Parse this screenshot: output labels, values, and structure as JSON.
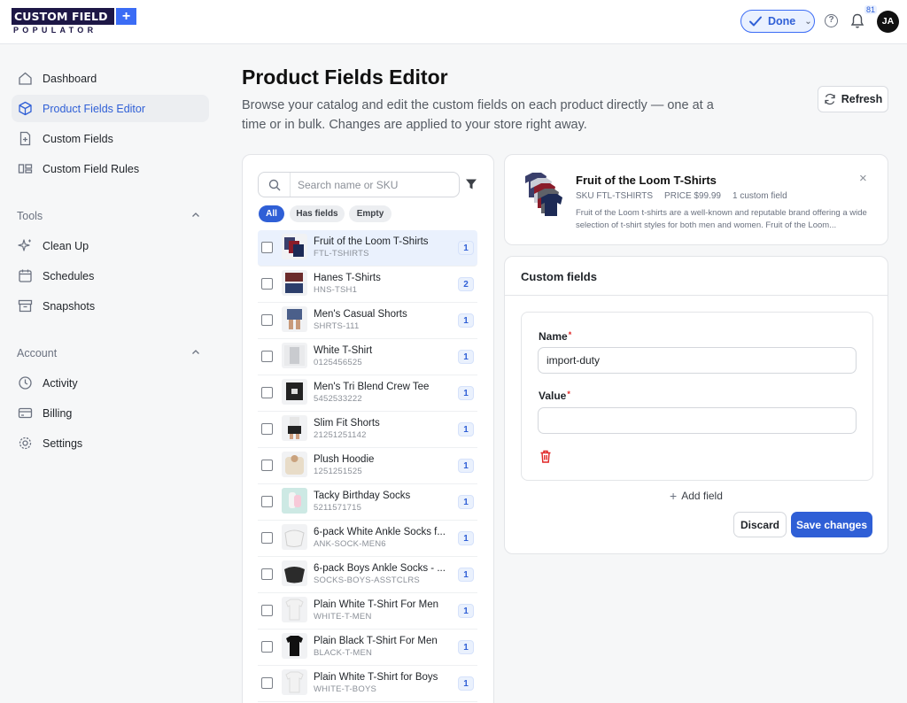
{
  "brand": {
    "line1": "CUSTOM FIELD",
    "line2": "POPULATOR"
  },
  "topbar": {
    "done_label": "Done",
    "notification_count": "81",
    "avatar_initials": "JA"
  },
  "sidebar": {
    "items": [
      {
        "label": "Dashboard",
        "icon": "home-icon"
      },
      {
        "label": "Product Fields Editor",
        "icon": "cube-icon",
        "active": true
      },
      {
        "label": "Custom Fields",
        "icon": "document-plus-icon"
      },
      {
        "label": "Custom Field Rules",
        "icon": "rules-icon"
      }
    ],
    "tools_label": "Tools",
    "tools": [
      {
        "label": "Clean Up",
        "icon": "sparkles-icon"
      },
      {
        "label": "Schedules",
        "icon": "calendar-icon"
      },
      {
        "label": "Snapshots",
        "icon": "archive-icon"
      }
    ],
    "account_label": "Account",
    "account": [
      {
        "label": "Activity",
        "icon": "clock-icon"
      },
      {
        "label": "Billing",
        "icon": "credit-card-icon"
      },
      {
        "label": "Settings",
        "icon": "gear-icon"
      }
    ]
  },
  "page": {
    "title": "Product Fields Editor",
    "description": "Browse your catalog and edit the custom fields on each product directly — one at a time or in bulk. Changes are applied to your store right away.",
    "refresh_label": "Refresh"
  },
  "list": {
    "search_placeholder": "Search name or SKU",
    "filters": [
      "All",
      "Has fields",
      "Empty"
    ],
    "active_filter": "All",
    "products": [
      {
        "name": "Fruit of the Loom T-Shirts",
        "sku": "FTL-TSHIRTS",
        "count": "1",
        "selected": true
      },
      {
        "name": "Hanes T-Shirts",
        "sku": "HNS-TSH1",
        "count": "2"
      },
      {
        "name": "Men's Casual Shorts",
        "sku": "SHRTS-111",
        "count": "1"
      },
      {
        "name": "White T-Shirt",
        "sku": "0125456525",
        "count": "1"
      },
      {
        "name": "Men's Tri Blend Crew Tee",
        "sku": "5452533222",
        "count": "1"
      },
      {
        "name": "Slim Fit Shorts",
        "sku": "21251251142",
        "count": "1"
      },
      {
        "name": "Plush Hoodie",
        "sku": "1251251525",
        "count": "1"
      },
      {
        "name": "Tacky Birthday Socks",
        "sku": "5211571715",
        "count": "1"
      },
      {
        "name": "6-pack White Ankle Socks f...",
        "sku": "ANK-SOCK-MEN6",
        "count": "1"
      },
      {
        "name": "6-pack Boys Ankle Socks - ...",
        "sku": "SOCKS-BOYS-ASSTCLRS",
        "count": "1"
      },
      {
        "name": "Plain White T-Shirt For Men",
        "sku": "WHITE-T-MEN",
        "count": "1"
      },
      {
        "name": "Plain Black T-Shirt For Men",
        "sku": "BLACK-T-MEN",
        "count": "1"
      },
      {
        "name": "Plain White T-Shirt for Boys",
        "sku": "WHITE-T-BOYS",
        "count": "1"
      }
    ]
  },
  "detail": {
    "title": "Fruit of the Loom T-Shirts",
    "sku": "SKU FTL-TSHIRTS",
    "price": "PRICE $99.99",
    "fields_count": "1 custom field",
    "description": "Fruit of the Loom t-shirts are a well-known and reputable brand offering a wide selection of t-shirt styles for both men and women. Fruit of the Loom..."
  },
  "fields": {
    "title": "Custom fields",
    "name_label": "Name",
    "name_value": "import-duty",
    "value_label": "Value",
    "value_value": "",
    "add_field_label": "Add field",
    "discard_label": "Discard",
    "save_label": "Save changes"
  },
  "colors": {
    "accent": "#2f5fd6",
    "brand_dark": "#1d1746",
    "danger": "#e02424"
  }
}
